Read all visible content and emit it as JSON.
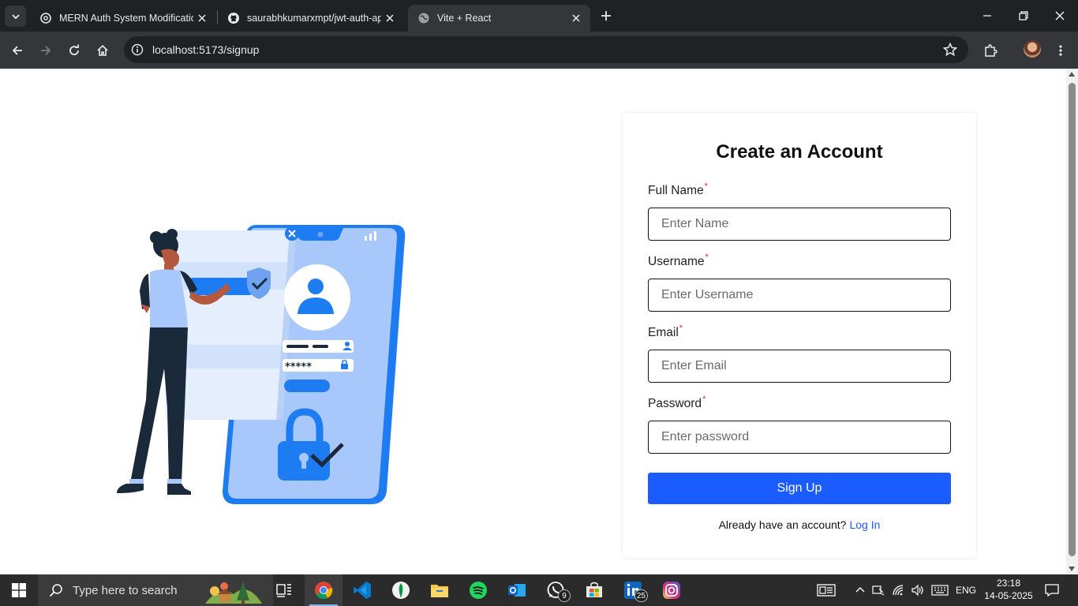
{
  "browser": {
    "tabs": [
      {
        "title": "MERN Auth System Modification",
        "favicon": "openai-icon",
        "active": false
      },
      {
        "title": "saurabhkumarxmpt/jwt-auth-ap",
        "favicon": "github-icon",
        "active": false
      },
      {
        "title": "Vite + React",
        "favicon": "globe-icon",
        "active": true
      }
    ],
    "address": "localhost:5173/signup"
  },
  "signup": {
    "title": "Create an Account",
    "required_mark": "*",
    "fields": [
      {
        "label": "Full Name",
        "placeholder": "Enter Name",
        "value": ""
      },
      {
        "label": "Username",
        "placeholder": "Enter Username",
        "value": ""
      },
      {
        "label": "Email",
        "placeholder": "Enter Email",
        "value": ""
      },
      {
        "label": "Password",
        "placeholder": "Enter password",
        "value": ""
      }
    ],
    "submit_label": "Sign Up",
    "footer_text": "Already have an account?",
    "login_link": "Log In"
  },
  "illustration": {
    "password_mask": "*****"
  },
  "taskbar": {
    "search_placeholder": "Type here to search",
    "apps": [
      {
        "name": "task-view",
        "active": false,
        "badge": ""
      },
      {
        "name": "chrome",
        "active": true,
        "badge": ""
      },
      {
        "name": "vscode",
        "active": false,
        "badge": ""
      },
      {
        "name": "mongodb-compass",
        "active": false,
        "badge": ""
      },
      {
        "name": "file-explorer",
        "active": false,
        "badge": ""
      },
      {
        "name": "spotify",
        "active": false,
        "badge": ""
      },
      {
        "name": "outlook",
        "active": false,
        "badge": ""
      },
      {
        "name": "whatsapp",
        "active": false,
        "badge": "9"
      },
      {
        "name": "microsoft-store",
        "active": false,
        "badge": ""
      },
      {
        "name": "linkedin",
        "active": false,
        "badge": "25"
      },
      {
        "name": "instagram",
        "active": false,
        "badge": ""
      }
    ],
    "language": "ENG",
    "time": "23:18",
    "date": "14-05-2025"
  },
  "colors": {
    "primary": "#1a5cff",
    "required": "#e02424",
    "illustration_blue": "#a8c8fb",
    "illustration_accent": "#1e7cf2"
  }
}
